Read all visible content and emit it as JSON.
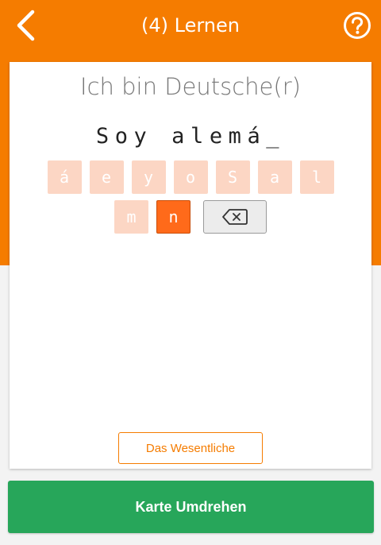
{
  "header": {
    "title": "(4) Lernen",
    "back_icon": "chevron-left-icon",
    "help_icon": "help-circle-icon"
  },
  "colors": {
    "accent": "#f57c00",
    "used_key": "#fcd6c4",
    "active_key": "#ff6a1a",
    "primary_action": "#27a65a"
  },
  "card": {
    "prompt": "Ich bin Deutsche(r)",
    "answer": "Soy alemá_"
  },
  "keyboard": {
    "row1": [
      {
        "label": "á",
        "state": "used"
      },
      {
        "label": "e",
        "state": "used"
      },
      {
        "label": "y",
        "state": "used"
      },
      {
        "label": "o",
        "state": "used"
      },
      {
        "label": "S",
        "state": "used"
      },
      {
        "label": "a",
        "state": "used"
      },
      {
        "label": "l",
        "state": "used"
      }
    ],
    "row2": [
      {
        "label": "m",
        "state": "used"
      },
      {
        "label": "n",
        "state": "active"
      }
    ],
    "backspace_icon": "backspace-icon"
  },
  "actions": {
    "essentials_label": "Das Wesentliche",
    "flip_label": "Karte Umdrehen"
  }
}
